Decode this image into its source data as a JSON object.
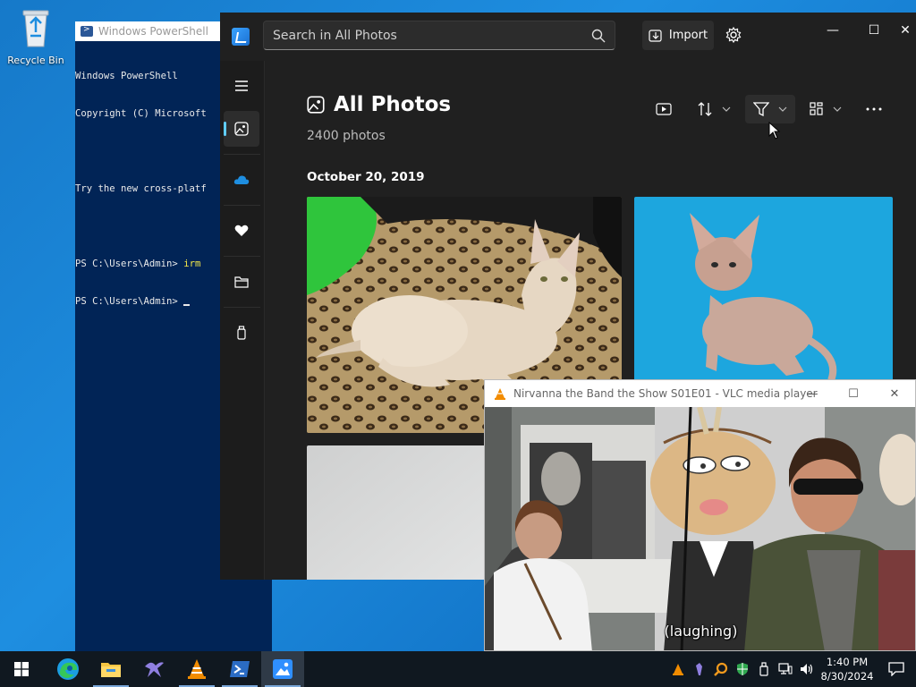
{
  "desktop": {
    "recycle_bin_label": "Recycle Bin"
  },
  "powershell": {
    "title": "Windows PowerShell",
    "lines": [
      "Windows PowerShell",
      "Copyright (C) Microsoft",
      "",
      "Try the new cross-platf",
      "",
      "PS C:\\Users\\Admin> ",
      "PS C:\\Users\\Admin> "
    ],
    "command": "irm"
  },
  "photos": {
    "search_placeholder": "Search in All Photos",
    "import_label": "Import",
    "heading": "All Photos",
    "count": "2400 photos",
    "date_group": "October 20, 2019",
    "colors": {
      "background": "#202020",
      "accent": "#60cdff"
    }
  },
  "vlc": {
    "title": "Nirvanna the Band the Show S01E01 - VLC media player",
    "subtitle": "(laughing)"
  },
  "taskbar": {
    "time": "1:40 PM",
    "date": "8/30/2024"
  }
}
